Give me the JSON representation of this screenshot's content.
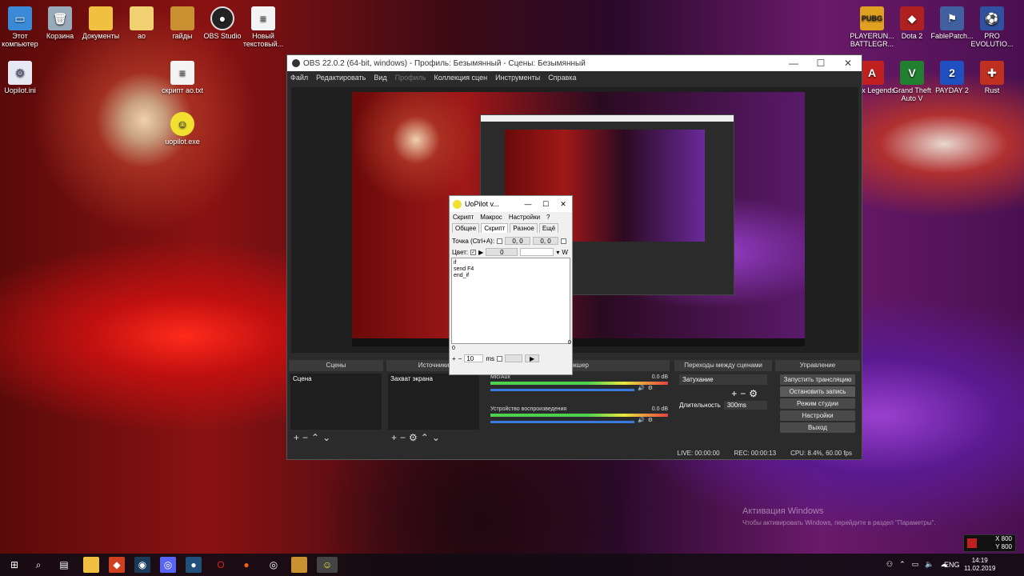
{
  "desktop": {
    "icons_left": [
      {
        "label": "Этот компьютер",
        "icon": "computer-icon"
      },
      {
        "label": "Корзина",
        "icon": "recycle-bin-icon"
      },
      {
        "label": "Документы",
        "icon": "folder-icon"
      },
      {
        "label": "ao",
        "icon": "folder-icon"
      },
      {
        "label": "гайды",
        "icon": "book-icon"
      },
      {
        "label": "OBS Studio",
        "icon": "obs-icon"
      },
      {
        "label": "Новый текстовый...",
        "icon": "text-file-icon"
      },
      {
        "label": "Uopilot.ini",
        "icon": "ini-file-icon"
      },
      {
        "label": "скрипт ao.txt",
        "icon": "text-file-icon"
      },
      {
        "label": "uopilot.exe",
        "icon": "smiley-icon"
      }
    ],
    "icons_right": [
      {
        "label": "PLAYERUN... BATTLEGR...",
        "icon": "pubg-icon"
      },
      {
        "label": "Dota 2",
        "icon": "dota-icon"
      },
      {
        "label": "FablePatch...",
        "icon": "fable-icon"
      },
      {
        "label": "PRO EVOLUTIO...",
        "icon": "pes-icon"
      },
      {
        "label": "Apex Legends",
        "icon": "apex-icon"
      },
      {
        "label": "Grand Theft Auto V",
        "icon": "gta-icon"
      },
      {
        "label": "PAYDAY 2",
        "icon": "payday-icon"
      },
      {
        "label": "Rust",
        "icon": "rust-icon"
      }
    ]
  },
  "obs": {
    "title": "OBS 22.0.2 (64-bit, windows) - Профиль: Безымянный - Сцены: Безымянный",
    "menu": [
      "Файл",
      "Редактировать",
      "Вид",
      "Профиль",
      "Коллекция сцен",
      "Инструменты",
      "Справка"
    ],
    "docks": {
      "scenes": {
        "header": "Сцены",
        "items": [
          "Сцена"
        ]
      },
      "sources": {
        "header": "Источники",
        "items": [
          "Захват экрана"
        ]
      },
      "mixer": {
        "header": "Микшер",
        "channels": [
          {
            "name": "Mic/Aux",
            "db": "0.0 dB"
          },
          {
            "name": "Устройство воспроизведения",
            "db": "0.0 dB"
          }
        ]
      },
      "transitions": {
        "header": "Переходы между сценами",
        "selected": "Затухание",
        "duration_label": "Длительность",
        "duration_value": "300ms"
      },
      "controls": {
        "header": "Управление",
        "buttons": [
          "Запустить трансляцию",
          "Остановить запись",
          "Режим студии",
          "Настройки",
          "Выход"
        ]
      }
    },
    "status": {
      "live": "LIVE: 00:00:00",
      "rec": "REC: 00:00:13",
      "cpu": "CPU: 8.4%, 60.00 fps"
    }
  },
  "uopilot": {
    "title": "UoPilot v...",
    "menu": [
      "Скрипт",
      "Макрос",
      "Настройки",
      "?"
    ],
    "tabs": [
      "Общее",
      "Скрипт",
      "Разное",
      "Ещё"
    ],
    "point_label": "Точка (Ctrl+A):",
    "point_x": "0, 0",
    "point_y": "0, 0",
    "color_label": "Цвет:",
    "color_value": "0",
    "w_label": "W",
    "script_lines": [
      "if",
      "send F4",
      "end_if"
    ],
    "counter": "0",
    "bottom_counter": "0",
    "interval_value": "10",
    "interval_unit": "ms"
  },
  "taskbar": {
    "lang": "ENG",
    "time": "14:19",
    "date": "11.02.2019",
    "xy_x": "X 800",
    "xy_y": "Y 800"
  },
  "watermark": {
    "line1": "Активация Windows",
    "line2": "Чтобы активировать Windows, перейдите в раздел \"Параметры\"."
  }
}
